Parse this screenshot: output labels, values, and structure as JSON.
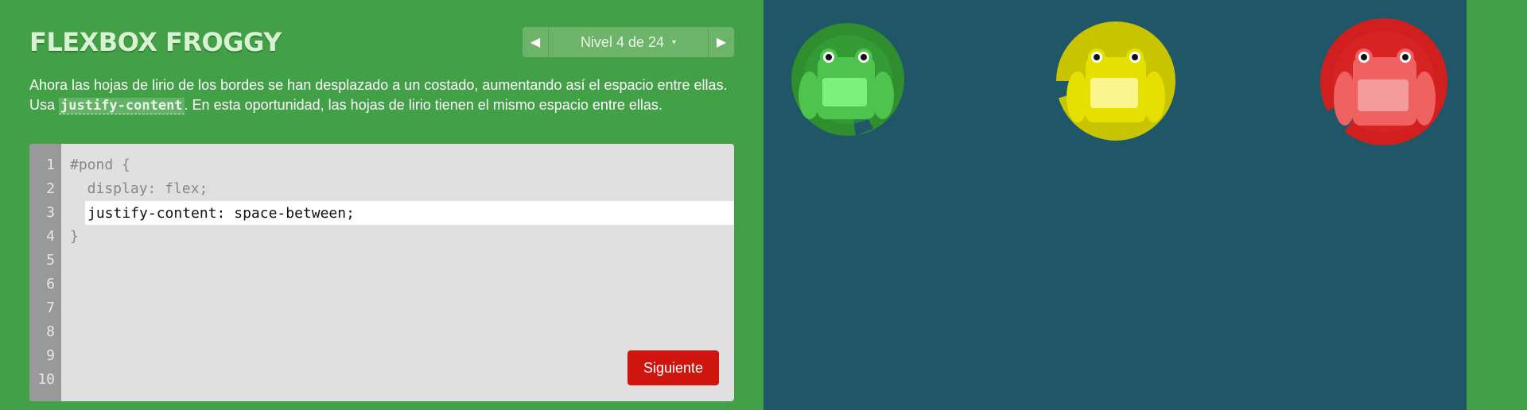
{
  "app": {
    "title": "FLEXBOX FROGGY"
  },
  "level_nav": {
    "prev_label": "◀",
    "next_label": "▶",
    "level_text": "Nivel 4 de 24",
    "caret": "▾"
  },
  "instructions": {
    "part1": "Ahora las hojas de lirio de los bordes se han desplazado a un costado, aumentando así el espacio entre ellas. Usa ",
    "code": "justify-content",
    "part2": ". En esta oportunidad, las hojas de lirio tienen el mismo espacio entre ellas."
  },
  "editor": {
    "line_numbers": [
      "1",
      "2",
      "3",
      "4",
      "5",
      "6",
      "7",
      "8",
      "9",
      "10"
    ],
    "line1": "#pond {",
    "line2": "  display: flex;",
    "input_value": "justify-content: space-between;",
    "line4": "}",
    "next_button": "Siguiente"
  },
  "pond": {
    "frogs": [
      {
        "color": "green",
        "pad": "#2f8f2f",
        "body": "#4ec34e",
        "belly": "#7cf27c"
      },
      {
        "color": "yellow",
        "pad": "#c9c400",
        "body": "#e6e000",
        "belly": "#fbf58d"
      },
      {
        "color": "red",
        "pad": "#d11f1f",
        "body": "#f06262",
        "belly": "#f49b9b"
      }
    ]
  },
  "colors": {
    "background": "#42a047",
    "pond": "#1f5768",
    "next_button": "#d0150f"
  }
}
